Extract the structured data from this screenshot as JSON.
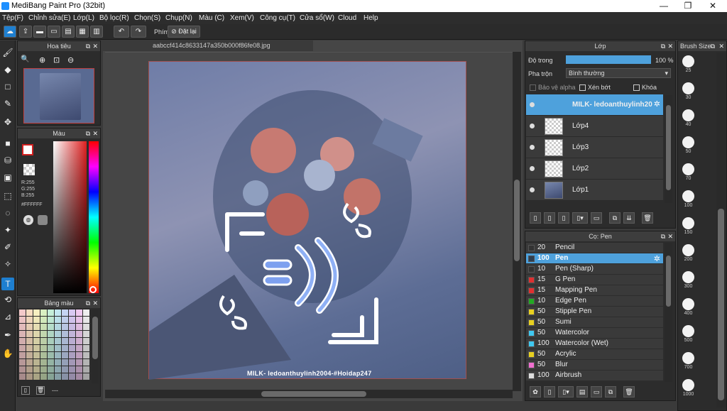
{
  "titlebar": {
    "title": "MediBang Paint Pro (32bit)",
    "minimize": "—",
    "maximize": "❐",
    "close": "✕"
  },
  "menu": [
    "Tệp(F)",
    "Chỉnh sửa(E)",
    "Lớp(L)",
    "Bộ lọc(R)",
    "Chọn(S)",
    "Chụp(N)",
    "Màu (C)",
    "Xem(V)",
    "Công cụ(T)",
    "Cửa sổ(W)",
    "Cloud",
    "Help"
  ],
  "toolbar": {
    "phim_label": "Phím",
    "reset_label": "Đặt lại"
  },
  "navigator": {
    "title": "Hoa tiêu"
  },
  "color": {
    "title": "Màu",
    "r": "R:255",
    "g": "G:255",
    "b": "B:255",
    "hex": "#FFFFFF"
  },
  "palette": {
    "title": "Bảng màu",
    "footer": "---"
  },
  "document": {
    "tab": "aabccf414c8633147a350b000f86fe08.jpg",
    "watermark": "MILK- ledoanthuylinh2004-#Hoidap247"
  },
  "layers": {
    "title": "Lớp",
    "opacity_label": "Độ trong",
    "opacity_value": "100 %",
    "opacity": 1.0,
    "blend_label": "Pha trộn",
    "blend_value": "Bình thường",
    "protect_alpha": "Bảo vệ alpha",
    "clip": "Xén bớt",
    "lock": "Khóa",
    "items": [
      "MILK- ledoanthuylinh20",
      "Lớp4",
      "Lớp3",
      "Lớp2",
      "Lớp1"
    ]
  },
  "pens": {
    "title": "Cọ: Pen",
    "items": [
      {
        "size": "20",
        "name": "Pencil",
        "color": "#333333"
      },
      {
        "size": "100",
        "name": "Pen",
        "color": "#2f3e4e"
      },
      {
        "size": "10",
        "name": "Pen (Sharp)",
        "color": "#333333"
      },
      {
        "size": "15",
        "name": "G Pen",
        "color": "#e03030"
      },
      {
        "size": "15",
        "name": "Mapping Pen",
        "color": "#e03030"
      },
      {
        "size": "10",
        "name": "Edge Pen",
        "color": "#22aa22"
      },
      {
        "size": "50",
        "name": "Stipple Pen",
        "color": "#e8d020"
      },
      {
        "size": "50",
        "name": "Sumi",
        "color": "#e8d020"
      },
      {
        "size": "50",
        "name": "Watercolor",
        "color": "#40c8f0"
      },
      {
        "size": "100",
        "name": "Watercolor (Wet)",
        "color": "#40c8f0"
      },
      {
        "size": "50",
        "name": "Acrylic",
        "color": "#e8d020"
      },
      {
        "size": "50",
        "name": "Blur",
        "color": "#f070d0"
      },
      {
        "size": "100",
        "name": "Airbrush",
        "color": "#dddddd"
      }
    ]
  },
  "brushsize": {
    "title": "Brush Size",
    "sizes": [
      "25",
      "30",
      "40",
      "50",
      "70",
      "100",
      "150",
      "200",
      "300",
      "400",
      "500",
      "700",
      "1000"
    ]
  }
}
